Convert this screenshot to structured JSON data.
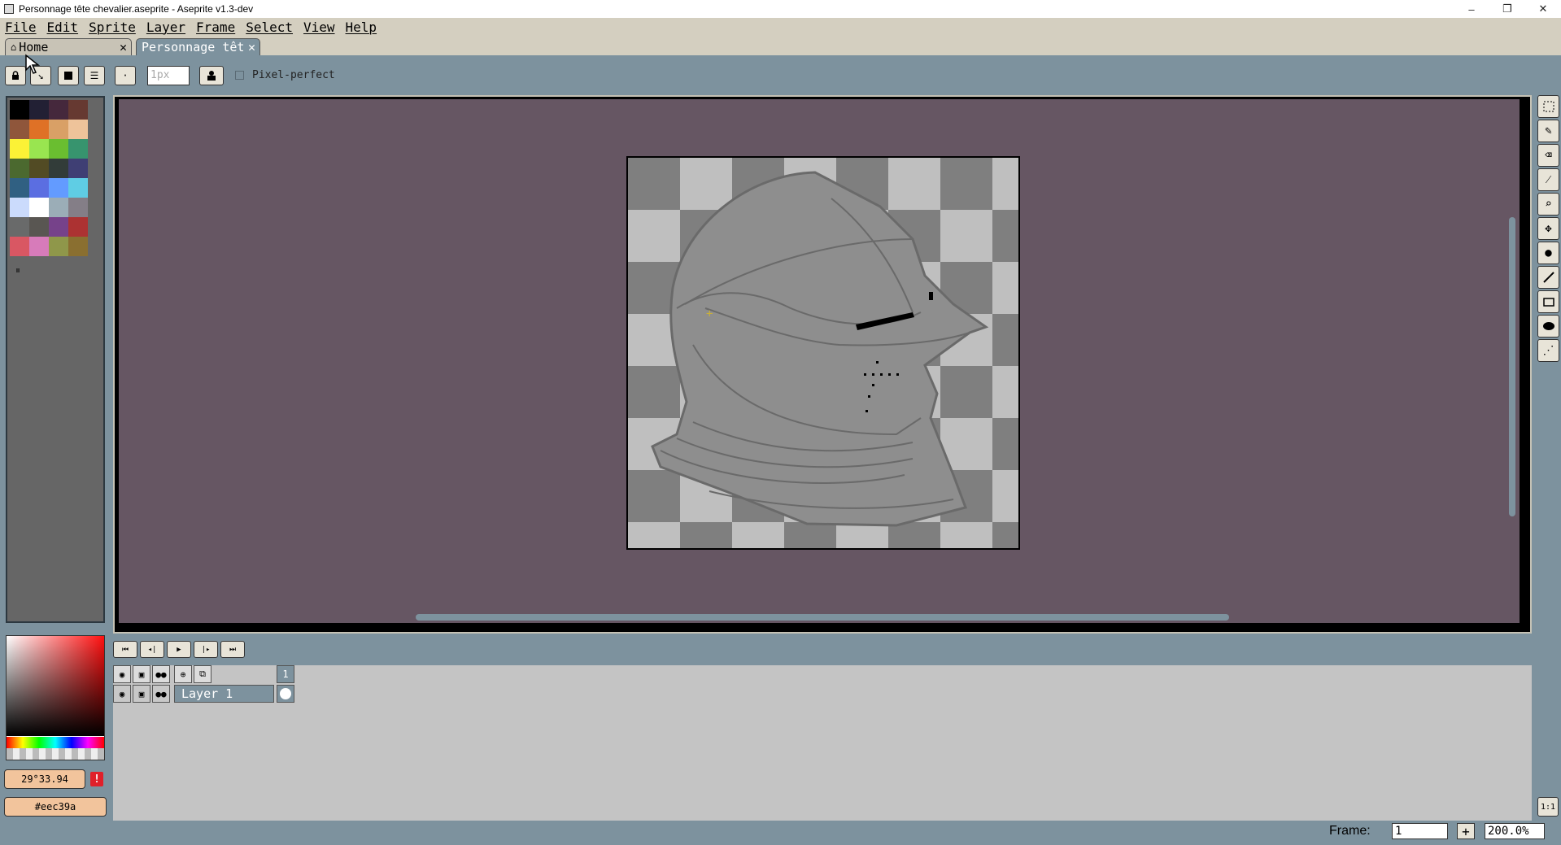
{
  "window": {
    "title": "Personnage tête chevalier.aseprite - Aseprite v1.3-dev",
    "minimize": "–",
    "maximize": "❐",
    "close": "✕"
  },
  "menu": [
    "File",
    "Edit",
    "Sprite",
    "Layer",
    "Frame",
    "Select",
    "View",
    "Help"
  ],
  "tabs": {
    "home_label": "Home",
    "doc_label": "Personnage têt",
    "close_glyph": "✕"
  },
  "toolbar": {
    "brush_size_placeholder": "1px",
    "pixel_perfect_label": "Pixel-perfect"
  },
  "palette": {
    "colors": [
      "#000000",
      "#222034",
      "#45283c",
      "#663931",
      "#8f563b",
      "#df7126",
      "#d9a066",
      "#eec39a",
      "#fbf236",
      "#99e550",
      "#6abe30",
      "#37946e",
      "#4b692f",
      "#524b24",
      "#323c39",
      "#3f3f74",
      "#306082",
      "#5b6ee1",
      "#639bff",
      "#5fcde4",
      "#cbdbfc",
      "#ffffff",
      "#9badb7",
      "#847e87",
      "#696a6a",
      "#595652",
      "#76428a",
      "#ac3232",
      "#d95763",
      "#d77bba",
      "#8f974a",
      "#8a6f30"
    ],
    "handle": "⏸"
  },
  "color": {
    "hsv_value": "29°33.94",
    "hex_value": "#eec39a",
    "warning": "!",
    "fg": "#eec39a"
  },
  "timeline": {
    "layer_name": "Layer 1",
    "frame_number": "1"
  },
  "status": {
    "frame_label": "Frame:",
    "frame_value": "1",
    "add_frame": "+",
    "zoom_value": "200.0%",
    "zoom_reset": "1:1"
  },
  "tools": [
    "rectangular-marquee",
    "pencil",
    "eraser",
    "eyedropper",
    "zoom",
    "move",
    "paint-bucket",
    "line",
    "rectangle",
    "ellipse",
    "spray"
  ]
}
